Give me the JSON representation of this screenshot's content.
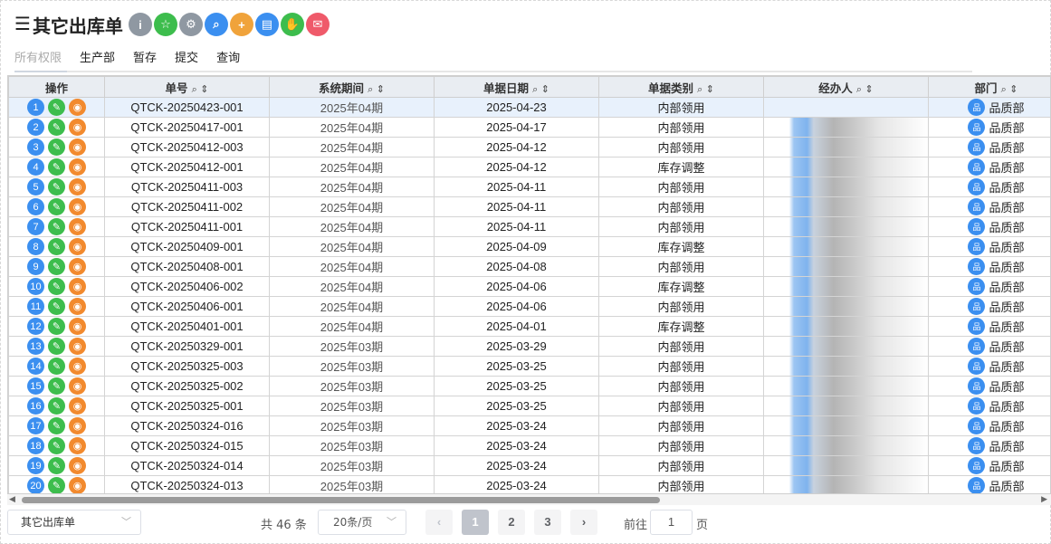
{
  "header": {
    "title": "其它出库单",
    "toolbar": [
      {
        "name": "info-button",
        "icon": "info-icon",
        "glyph": "i",
        "color": "gray"
      },
      {
        "name": "favorite-button",
        "icon": "star-icon",
        "glyph": "☆",
        "color": "green"
      },
      {
        "name": "settings-button",
        "icon": "gear-icon",
        "glyph": "⚙",
        "color": "gray"
      },
      {
        "name": "search-button",
        "icon": "search-icon",
        "glyph": "⌕",
        "color": "blue"
      },
      {
        "name": "add-button",
        "icon": "plus-icon",
        "glyph": "+",
        "color": "orange"
      },
      {
        "name": "export-button",
        "icon": "document-icon",
        "glyph": "▤",
        "color": "blue"
      },
      {
        "name": "approve-button",
        "icon": "hand-icon",
        "glyph": "✋",
        "color": "green"
      },
      {
        "name": "mail-button",
        "icon": "mail-icon",
        "glyph": "✉",
        "color": "red"
      }
    ]
  },
  "tabs": [
    "所有权限",
    "生产部",
    "暂存",
    "提交",
    "查询"
  ],
  "columns": [
    "操作",
    "单号",
    "系统期间",
    "单据日期",
    "单据类别",
    "经办人",
    "部门"
  ],
  "rows": [
    {
      "no": "1",
      "id": "QTCK-20250423-001",
      "period": "2025年04期",
      "date": "2025-04-23",
      "type": "内部领用",
      "dept": "品质部"
    },
    {
      "no": "2",
      "id": "QTCK-20250417-001",
      "period": "2025年04期",
      "date": "2025-04-17",
      "type": "内部领用",
      "dept": "品质部"
    },
    {
      "no": "3",
      "id": "QTCK-20250412-003",
      "period": "2025年04期",
      "date": "2025-04-12",
      "type": "内部领用",
      "dept": "品质部"
    },
    {
      "no": "4",
      "id": "QTCK-20250412-001",
      "period": "2025年04期",
      "date": "2025-04-12",
      "type": "库存调整",
      "dept": "品质部"
    },
    {
      "no": "5",
      "id": "QTCK-20250411-003",
      "period": "2025年04期",
      "date": "2025-04-11",
      "type": "内部领用",
      "dept": "品质部"
    },
    {
      "no": "6",
      "id": "QTCK-20250411-002",
      "period": "2025年04期",
      "date": "2025-04-11",
      "type": "内部领用",
      "dept": "品质部"
    },
    {
      "no": "7",
      "id": "QTCK-20250411-001",
      "period": "2025年04期",
      "date": "2025-04-11",
      "type": "内部领用",
      "dept": "品质部"
    },
    {
      "no": "8",
      "id": "QTCK-20250409-001",
      "period": "2025年04期",
      "date": "2025-04-09",
      "type": "库存调整",
      "dept": "品质部"
    },
    {
      "no": "9",
      "id": "QTCK-20250408-001",
      "period": "2025年04期",
      "date": "2025-04-08",
      "type": "内部领用",
      "dept": "品质部"
    },
    {
      "no": "10",
      "id": "QTCK-20250406-002",
      "period": "2025年04期",
      "date": "2025-04-06",
      "type": "库存调整",
      "dept": "品质部"
    },
    {
      "no": "11",
      "id": "QTCK-20250406-001",
      "period": "2025年04期",
      "date": "2025-04-06",
      "type": "内部领用",
      "dept": "品质部"
    },
    {
      "no": "12",
      "id": "QTCK-20250401-001",
      "period": "2025年04期",
      "date": "2025-04-01",
      "type": "库存调整",
      "dept": "品质部"
    },
    {
      "no": "13",
      "id": "QTCK-20250329-001",
      "period": "2025年03期",
      "date": "2025-03-29",
      "type": "内部领用",
      "dept": "品质部"
    },
    {
      "no": "14",
      "id": "QTCK-20250325-003",
      "period": "2025年03期",
      "date": "2025-03-25",
      "type": "内部领用",
      "dept": "品质部"
    },
    {
      "no": "15",
      "id": "QTCK-20250325-002",
      "period": "2025年03期",
      "date": "2025-03-25",
      "type": "内部领用",
      "dept": "品质部"
    },
    {
      "no": "16",
      "id": "QTCK-20250325-001",
      "period": "2025年03期",
      "date": "2025-03-25",
      "type": "内部领用",
      "dept": "品质部"
    },
    {
      "no": "17",
      "id": "QTCK-20250324-016",
      "period": "2025年03期",
      "date": "2025-03-24",
      "type": "内部领用",
      "dept": "品质部"
    },
    {
      "no": "18",
      "id": "QTCK-20250324-015",
      "period": "2025年03期",
      "date": "2025-03-24",
      "type": "内部领用",
      "dept": "品质部"
    },
    {
      "no": "19",
      "id": "QTCK-20250324-014",
      "period": "2025年03期",
      "date": "2025-03-24",
      "type": "内部领用",
      "dept": "品质部"
    },
    {
      "no": "20",
      "id": "QTCK-20250324-013",
      "period": "2025年03期",
      "date": "2025-03-24",
      "type": "内部领用",
      "dept": "品质部"
    }
  ],
  "footer": {
    "view_select": "其它出库单",
    "total": "共 46 条",
    "page_size": "20条/页",
    "prev": "‹",
    "pages": [
      "1",
      "2",
      "3"
    ],
    "next": "›",
    "goto_label": "前往",
    "goto_value": "1",
    "goto_unit": "页"
  },
  "colors": {
    "blue": "#3b8ff0",
    "green": "#3dbd4d",
    "orange": "#f28a2e",
    "header_bg": "#e9edf2"
  }
}
